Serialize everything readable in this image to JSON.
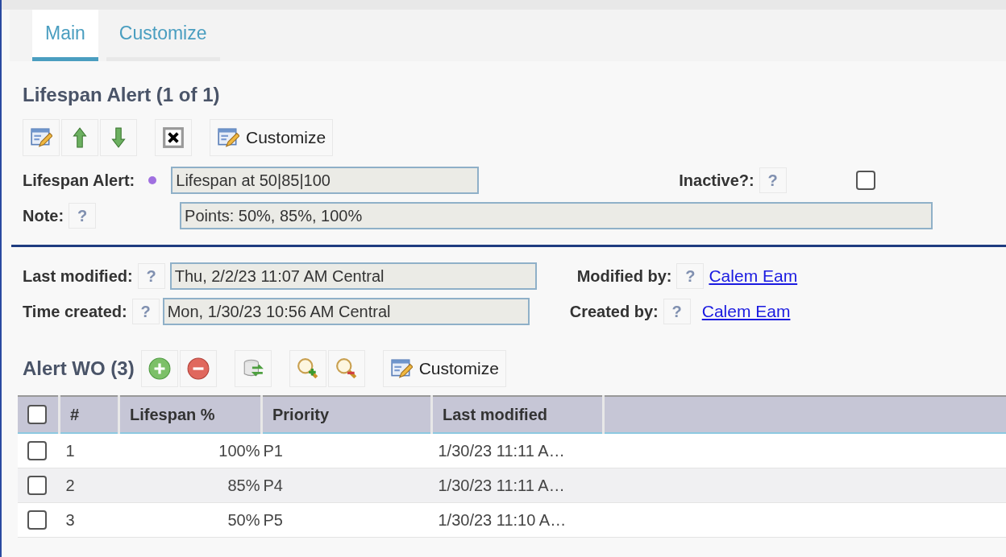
{
  "tabs": [
    {
      "label": "Main",
      "selected": true
    },
    {
      "label": "Customize",
      "selected": false
    }
  ],
  "record": {
    "title": "Lifespan Alert (1 of 1)",
    "toolbar": [
      {
        "kind": "edit"
      },
      {
        "kind": "up"
      },
      {
        "kind": "down"
      },
      {
        "kind": "gap"
      },
      {
        "kind": "delete"
      },
      {
        "kind": "gap"
      },
      {
        "kind": "customize",
        "label": "Customize"
      }
    ],
    "lifespan_alert": {
      "label": "Lifespan Alert:",
      "value": "Lifespan at 50|85|100"
    },
    "inactive": {
      "label": "Inactive?:",
      "help": "?",
      "checked": false
    },
    "note": {
      "label": "Note:",
      "help": "?",
      "value": "Points: 50%, 85%, 100%"
    },
    "last_modified": {
      "label": "Last modified:",
      "help": "?",
      "value": "Thu, 2/2/23 11:07 AM Central"
    },
    "modified_by": {
      "label": "Modified by:",
      "help": "?",
      "value": "Calem Eam"
    },
    "time_created": {
      "label": "Time created:",
      "help": "?",
      "value": "Mon, 1/30/23 10:56 AM Central"
    },
    "created_by": {
      "label": "Created by:",
      "help": "?",
      "value": "Calem Eam"
    }
  },
  "alert_wo": {
    "title": "Alert WO (3)",
    "toolbar": [
      {
        "kind": "add"
      },
      {
        "kind": "remove"
      },
      {
        "kind": "gap"
      },
      {
        "kind": "refresh"
      },
      {
        "kind": "gap"
      },
      {
        "kind": "zoom_in"
      },
      {
        "kind": "zoom_out"
      },
      {
        "kind": "gap"
      },
      {
        "kind": "customize",
        "label": "Customize"
      }
    ],
    "table": {
      "select_all": false,
      "columns": [
        "#",
        "Lifespan %",
        "Priority",
        "Last modified"
      ],
      "rows": [
        {
          "checked": false,
          "cells": [
            "1",
            "100%",
            "P1",
            "1/30/23 11:11 A…"
          ]
        },
        {
          "checked": false,
          "cells": [
            "2",
            "85%",
            "P4",
            "1/30/23 11:11 A…"
          ]
        },
        {
          "checked": false,
          "cells": [
            "3",
            "50%",
            "P5",
            "1/30/23 11:10 A…"
          ]
        }
      ]
    }
  }
}
